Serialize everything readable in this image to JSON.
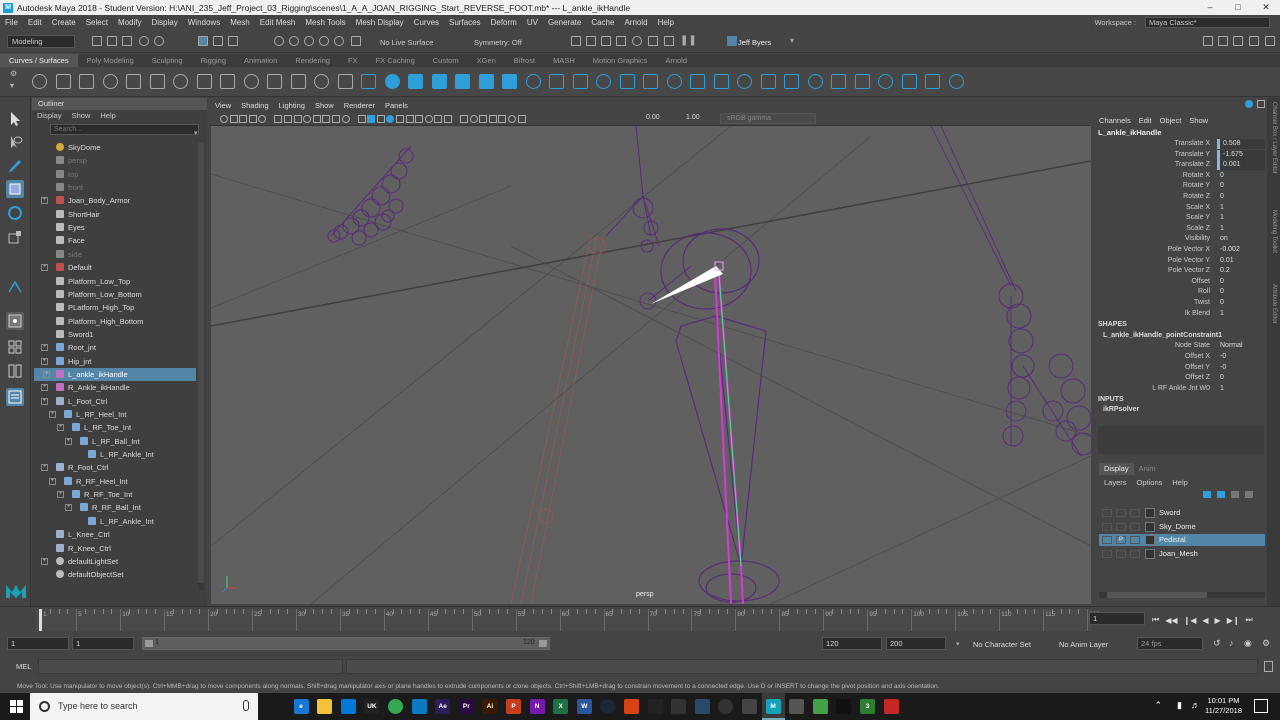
{
  "window": {
    "title": "Autodesk Maya 2018 - Student Version: H:\\ANI_235_Jeff_Project_03_Rigging\\scenes\\1_A_A_JOAN_RIGGING_Start_REVERSE_FOOT.mb*  ---  L_ankle_ikHandle"
  },
  "menubar": {
    "items": [
      "File",
      "Edit",
      "Create",
      "Select",
      "Modify",
      "Display",
      "Windows",
      "Mesh",
      "Edit Mesh",
      "Mesh Tools",
      "Mesh Display",
      "Curves",
      "Surfaces",
      "Deform",
      "UV",
      "Generate",
      "Cache",
      "Arnold",
      "Help"
    ],
    "workspace_label": "Workspace :",
    "workspace_value": "Maya Classic*"
  },
  "statusline": {
    "mode": "Modeling",
    "live_surface": "No Live Surface",
    "symmetry": "Symmetry: Off",
    "user": "Jeff Byers"
  },
  "shelf": {
    "tabs": [
      "Curves / Surfaces",
      "Poly Modeling",
      "Sculpting",
      "Rigging",
      "Animation",
      "Rendering",
      "FX",
      "FX Caching",
      "Custom",
      "XGen",
      "Bifrost",
      "MASH",
      "Motion Graphics",
      "Arnold"
    ],
    "active_tab": "Curves / Surfaces"
  },
  "outliner": {
    "title": "Outliner",
    "menu": [
      "Display",
      "Show",
      "Help"
    ],
    "search_placeholder": "Search...",
    "items": [
      {
        "label": "SkyDome",
        "indent": 0,
        "dim": false,
        "icon": "sky-icon",
        "expand": false
      },
      {
        "label": "persp",
        "indent": 0,
        "dim": true,
        "icon": "camera-icon",
        "expand": false
      },
      {
        "label": "top",
        "indent": 0,
        "dim": true,
        "icon": "camera-icon",
        "expand": false
      },
      {
        "label": "front",
        "indent": 0,
        "dim": true,
        "icon": "camera-icon",
        "expand": false
      },
      {
        "label": "Joan_Body_Armor",
        "indent": 0,
        "dim": false,
        "icon": "group-icon",
        "expand": true
      },
      {
        "label": "ShortHair",
        "indent": 0,
        "dim": false,
        "icon": "mesh-icon",
        "expand": false
      },
      {
        "label": "Eyes",
        "indent": 0,
        "dim": false,
        "icon": "mesh-icon",
        "expand": false
      },
      {
        "label": "Face",
        "indent": 0,
        "dim": false,
        "icon": "mesh-icon",
        "expand": false
      },
      {
        "label": "side",
        "indent": 0,
        "dim": true,
        "icon": "camera-icon",
        "expand": false
      },
      {
        "label": "Default",
        "indent": 0,
        "dim": false,
        "icon": "group-icon",
        "expand": true
      },
      {
        "label": "Platform_Low_Top",
        "indent": 0,
        "dim": false,
        "icon": "mesh-icon",
        "expand": false
      },
      {
        "label": "Platform_Low_Bottom",
        "indent": 0,
        "dim": false,
        "icon": "mesh-icon",
        "expand": false
      },
      {
        "label": "PLatform_High_Top",
        "indent": 0,
        "dim": false,
        "icon": "mesh-icon",
        "expand": false
      },
      {
        "label": "Platform_High_Bottom",
        "indent": 0,
        "dim": false,
        "icon": "mesh-icon",
        "expand": false
      },
      {
        "label": "Sword1",
        "indent": 0,
        "dim": false,
        "icon": "mesh-icon",
        "expand": false
      },
      {
        "label": "Root_jnt",
        "indent": 0,
        "dim": false,
        "icon": "joint-icon",
        "expand": true
      },
      {
        "label": "Hip_jnt",
        "indent": 0,
        "dim": false,
        "icon": "joint-icon",
        "expand": true
      },
      {
        "label": "L_ankle_ikHandle",
        "indent": 0,
        "dim": false,
        "icon": "ikhandle-icon",
        "expand": true,
        "selected": true
      },
      {
        "label": "R_Ankle_ikHandle",
        "indent": 0,
        "dim": false,
        "icon": "ikhandle-icon",
        "expand": true
      },
      {
        "label": "L_Foot_Ctrl",
        "indent": 0,
        "dim": false,
        "icon": "curve-icon",
        "expand": true
      },
      {
        "label": "L_RF_Heel_Int",
        "indent": 1,
        "dim": false,
        "icon": "joint-icon",
        "expand": true
      },
      {
        "label": "L_RF_Toe_Int",
        "indent": 2,
        "dim": false,
        "icon": "joint-icon",
        "expand": true
      },
      {
        "label": "L_RF_Ball_Int",
        "indent": 3,
        "dim": false,
        "icon": "joint-icon",
        "expand": true
      },
      {
        "label": "L_RF_Ankle_Int",
        "indent": 4,
        "dim": false,
        "icon": "joint-icon",
        "expand": false
      },
      {
        "label": "R_Foot_Ctrl",
        "indent": 0,
        "dim": false,
        "icon": "curve-icon",
        "expand": true
      },
      {
        "label": "R_RF_Heel_Int",
        "indent": 1,
        "dim": false,
        "icon": "joint-icon",
        "expand": true
      },
      {
        "label": "R_RF_Toe_Int",
        "indent": 2,
        "dim": false,
        "icon": "joint-icon",
        "expand": true
      },
      {
        "label": "R_RF_Ball_Int",
        "indent": 3,
        "dim": false,
        "icon": "joint-icon",
        "expand": true
      },
      {
        "label": "L_RF_Ankle_Int",
        "indent": 4,
        "dim": false,
        "icon": "joint-icon",
        "expand": false
      },
      {
        "label": "L_Knee_Ctrl",
        "indent": 0,
        "dim": false,
        "icon": "curve-icon",
        "expand": false
      },
      {
        "label": "R_Knee_Ctrl",
        "indent": 0,
        "dim": false,
        "icon": "curve-icon",
        "expand": false
      },
      {
        "label": "defaultLightSet",
        "indent": 0,
        "dim": false,
        "icon": "set-icon",
        "expand": true
      },
      {
        "label": "defaultObjectSet",
        "indent": 0,
        "dim": false,
        "icon": "set-icon",
        "expand": false
      }
    ]
  },
  "viewport": {
    "menu": [
      "View",
      "Shading",
      "Lighting",
      "Show",
      "Renderer",
      "Panels"
    ],
    "near_value": "0.00",
    "far_value": "1.00",
    "color_space": "sRGB gamma",
    "camera": "persp"
  },
  "channelbox": {
    "menu": [
      "Channels",
      "Edit",
      "Object",
      "Show"
    ],
    "object_name": "L_ankle_ikHandle",
    "attributes": [
      {
        "name": "Translate X",
        "value": "0.508",
        "hl": true
      },
      {
        "name": "Translate Y",
        "value": "-1.675",
        "hl": true
      },
      {
        "name": "Translate Z",
        "value": "0.001",
        "hl": true
      },
      {
        "name": "Rotate X",
        "value": "0"
      },
      {
        "name": "Rotate Y",
        "value": "0"
      },
      {
        "name": "Rotate Z",
        "value": "0"
      },
      {
        "name": "Scale X",
        "value": "1"
      },
      {
        "name": "Scale Y",
        "value": "1"
      },
      {
        "name": "Scale Z",
        "value": "1"
      },
      {
        "name": "Visibility",
        "value": "on"
      },
      {
        "name": "Pole Vector X",
        "value": "-0.002"
      },
      {
        "name": "Pole Vector Y",
        "value": "0.01"
      },
      {
        "name": "Pole Vector Z",
        "value": "0.2"
      },
      {
        "name": "Offset",
        "value": "0"
      },
      {
        "name": "Roll",
        "value": "0"
      },
      {
        "name": "Twist",
        "value": "0"
      },
      {
        "name": "Ik Blend",
        "value": "1"
      }
    ],
    "shapes_label": "SHAPES",
    "shape_name": "L_ankle_ikHandle_pointConstraint1",
    "shape_attributes": [
      {
        "name": "Node State",
        "value": "Normal"
      },
      {
        "name": "Offset X",
        "value": "-0"
      },
      {
        "name": "Offset Y",
        "value": "-0"
      },
      {
        "name": "Offset Z",
        "value": "0"
      },
      {
        "name": "L RF Ankle Jnt W0",
        "value": "1"
      }
    ],
    "inputs_label": "INPUTS",
    "input_name": "ikRPsolver",
    "side_tabs": [
      "Channel Box / Layer Editor",
      "Modeling Toolkit",
      "Attribute Editor"
    ]
  },
  "layers": {
    "tabs": [
      "Display",
      "Anim"
    ],
    "menu": [
      "Layers",
      "Options",
      "Help"
    ],
    "items": [
      {
        "name": "Sword",
        "p": "",
        "selected": false
      },
      {
        "name": "Sky_Dome",
        "p": "",
        "selected": false
      },
      {
        "name": "Pedistal",
        "p": "P",
        "selected": true
      },
      {
        "name": "Joan_Mesh",
        "p": "",
        "selected": false
      }
    ]
  },
  "timeline": {
    "tick_labels": [
      "1",
      "5",
      "10",
      "15",
      "20",
      "25",
      "30",
      "35",
      "40",
      "45",
      "50",
      "55",
      "60",
      "65",
      "70",
      "75",
      "80",
      "85",
      "90",
      "95",
      "100",
      "105",
      "110",
      "115",
      "120"
    ],
    "current_frame": "1",
    "range_start": "1",
    "playback_start": "1",
    "slider_start": "1",
    "slider_end": "120",
    "playback_end": "120",
    "range_end": "200",
    "character_set": "No Character Set",
    "anim_layer": "No Anim Layer",
    "fps": "24 fps"
  },
  "cmdline": {
    "label": "MEL",
    "help": "Move Tool: Use manipulator to move object(s). Ctrl+MMB+drag to move components along normals. Shift+drag manipulator axis or plane handles to extrude components or clone objects. Ctrl+Shift+LMB+drag to constrain movement to a connected edge. Use D or INSERT to change the pivot position and axis orientation."
  },
  "taskbar": {
    "search_placeholder": "Type here to search",
    "apps": [
      {
        "name": "task-view-icon",
        "label": "",
        "color": "#1a1a1a"
      },
      {
        "name": "edge-icon",
        "label": "e",
        "color": "#1976d2"
      },
      {
        "name": "file-explorer-icon",
        "label": "",
        "color": "#f3c13a"
      },
      {
        "name": "store-icon",
        "label": "",
        "color": "#0078d7"
      },
      {
        "name": "unreal-icon",
        "label": "UK",
        "color": "#222"
      },
      {
        "name": "chrome-icon",
        "label": "",
        "color": "#34a853"
      },
      {
        "name": "photos-icon",
        "label": "",
        "color": "#0a7bc2"
      },
      {
        "name": "after-effects-icon",
        "label": "Ae",
        "color": "#2b1c5a"
      },
      {
        "name": "premiere-icon",
        "label": "Pr",
        "color": "#2a0a3f"
      },
      {
        "name": "illustrator-icon",
        "label": "Ai",
        "color": "#3a1a00"
      },
      {
        "name": "powerpoint-icon",
        "label": "P",
        "color": "#c43e1c"
      },
      {
        "name": "onenote-icon",
        "label": "N",
        "color": "#7719aa"
      },
      {
        "name": "excel-icon",
        "label": "X",
        "color": "#1e7145"
      },
      {
        "name": "word-icon",
        "label": "W",
        "color": "#2b579a"
      },
      {
        "name": "steam-icon",
        "label": "",
        "color": "#1b2838"
      },
      {
        "name": "app-red-icon",
        "label": "",
        "color": "#d84315"
      },
      {
        "name": "media-player-icon",
        "label": "",
        "color": "#222"
      },
      {
        "name": "app-icon",
        "label": "",
        "color": "#333"
      },
      {
        "name": "photoshop-icon",
        "label": "",
        "color": "#2a4a6a"
      },
      {
        "name": "app-circle-icon",
        "label": "",
        "color": "#333"
      },
      {
        "name": "app-dark-icon",
        "label": "",
        "color": "#444"
      },
      {
        "name": "maya-icon",
        "label": "M",
        "color": "#17a2b8"
      },
      {
        "name": "app-gray-icon",
        "label": "",
        "color": "#555"
      },
      {
        "name": "green-app-icon",
        "label": "",
        "color": "#43a047"
      },
      {
        "name": "unreal-engine-icon",
        "label": "",
        "color": "#111"
      },
      {
        "name": "app-3-icon",
        "label": "3",
        "color": "#2e7d32"
      },
      {
        "name": "app-red2-icon",
        "label": "",
        "color": "#c62828"
      }
    ],
    "time": "10:01 PM",
    "date": "11/27/2018"
  }
}
